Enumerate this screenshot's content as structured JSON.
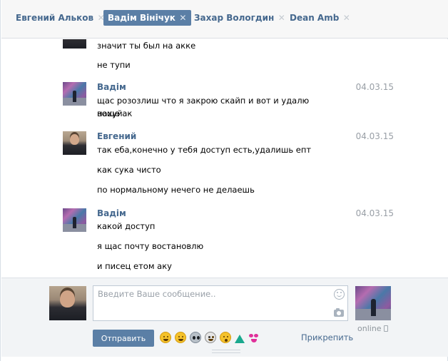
{
  "tabs": [
    {
      "label": "Евгений Альков",
      "active": false
    },
    {
      "label": "Вадім Вінічук",
      "active": true
    },
    {
      "label": "Захар Вологдин",
      "active": false
    },
    {
      "label": "Dean Amb",
      "active": false
    }
  ],
  "messages": {
    "m0": {
      "lines": [
        "значит ты был на акке",
        "не тупи"
      ]
    },
    "m1": {
      "sender": "Вадім",
      "date": "04.03.15",
      "lines": [
        "щас розозлиш что я закрою скайп и вот и удалю воще ак",
        "нахуй"
      ]
    },
    "m2": {
      "sender": "Евгений",
      "date": "04.03.15",
      "lines": [
        "так еба,конечно у тебя доступ есть,удалишь епт",
        "как сука чисто",
        "по нормальному нечего не делаешь"
      ]
    },
    "m3": {
      "sender": "Вадім",
      "date": "04.03.15",
      "lines": [
        "какой доступ",
        "я щас почту востановлю",
        "и писец етом аку"
      ]
    }
  },
  "compose": {
    "placeholder": "Введите Ваше сообщение..",
    "send_label": "Отправить",
    "attach_label": "Прикрепить",
    "peer_status": "online",
    "emojis": [
      "laughing-emoji",
      "smile-emoji",
      "alien-emoji",
      "skull-emoji",
      "shocked-emoji",
      "dress-emoji",
      "bikini-emoji"
    ]
  },
  "colors": {
    "accent": "#5b7fa6",
    "link": "#45688e",
    "date": "#999fa6"
  }
}
